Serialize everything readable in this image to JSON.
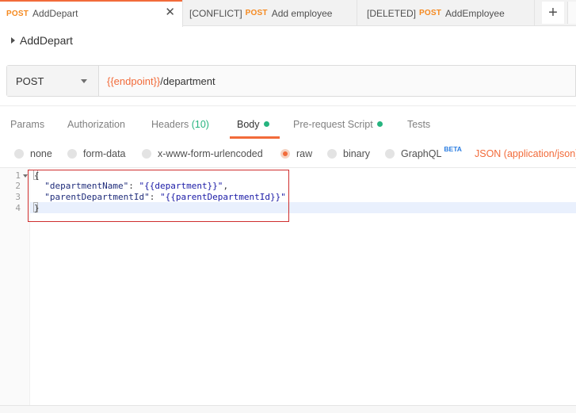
{
  "tabs": [
    {
      "method": "POST",
      "label": "AddDepart",
      "active": true
    },
    {
      "prefix": "[CONFLICT]",
      "method": "POST",
      "label": "Add employee",
      "active": false
    },
    {
      "prefix": "[DELETED]",
      "method": "POST",
      "label": "AddEmployee",
      "active": false
    }
  ],
  "close_glyph": "✕",
  "new_tab_glyph": "+",
  "request": {
    "name": "AddDepart"
  },
  "urlbar": {
    "method": "POST",
    "url_variable": "{{endpoint}}",
    "url_path": "/department"
  },
  "subtabs": {
    "params": "Params",
    "authorization": "Authorization",
    "headers": "Headers",
    "headers_count": "(10)",
    "body": "Body",
    "prerequest": "Pre-request Script",
    "tests": "Tests",
    "active": "Body"
  },
  "body_types": {
    "none": "none",
    "form_data": "form-data",
    "urlencoded": "x-www-form-urlencoded",
    "raw": "raw",
    "binary": "binary",
    "graphql": "GraphQL",
    "beta": "BETA",
    "selected": "raw",
    "content_type": "JSON (application/json)"
  },
  "editor": {
    "line_numbers": [
      "1",
      "2",
      "3",
      "4"
    ],
    "open_brace": "{",
    "close_brace": "}",
    "line2": {
      "key": "\"departmentName\"",
      "colon": ": ",
      "value": "\"{{department}}\"",
      "trail": ","
    },
    "line3": {
      "key": "\"parentDepartmentId\"",
      "colon": ": ",
      "value": "\"{{parentDepartmentId}}\""
    }
  },
  "colors": {
    "accent": "#f26b3a",
    "method_post": "#f5891f",
    "status_green": "#26b47f",
    "beta_blue": "#2a7de1",
    "annotation_red": "#cf2e2e"
  }
}
